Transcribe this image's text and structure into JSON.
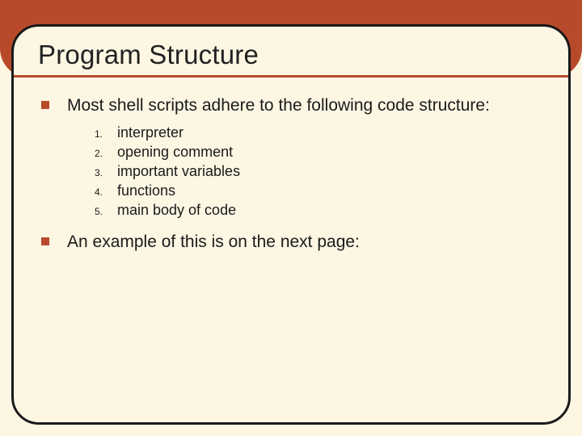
{
  "slide": {
    "title": "Program Structure",
    "bullets": [
      {
        "text": "Most shell scripts adhere to the following code structure:",
        "items": [
          "interpreter",
          "opening comment",
          "important variables",
          "functions",
          "main body of code"
        ]
      },
      {
        "text": "An example of this is on the next page:",
        "items": []
      }
    ]
  },
  "colors": {
    "accent": "#b84a2b",
    "background": "#fdf6e3",
    "text": "#1a1a1a"
  }
}
